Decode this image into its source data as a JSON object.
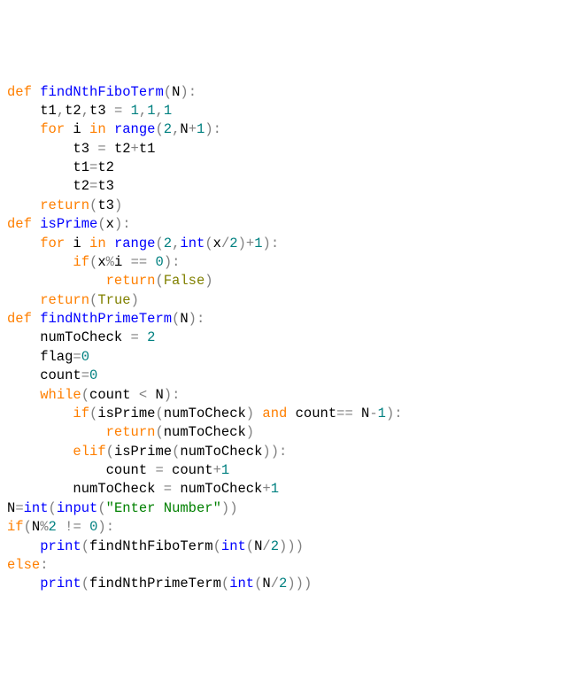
{
  "code": {
    "lines": [
      [
        [
          "kw",
          "def "
        ],
        [
          "fn",
          "findNthFiboTerm"
        ],
        [
          "op",
          "("
        ],
        [
          "",
          "N"
        ],
        [
          "op",
          ")"
        ],
        [
          "op",
          ":"
        ]
      ],
      [
        [
          "",
          "    t1"
        ],
        [
          "op",
          ","
        ],
        [
          "",
          "t2"
        ],
        [
          "op",
          ","
        ],
        [
          "",
          "t3 "
        ],
        [
          "op",
          "="
        ],
        [
          "",
          " "
        ],
        [
          "num",
          "1"
        ],
        [
          "op",
          ","
        ],
        [
          "num",
          "1"
        ],
        [
          "op",
          ","
        ],
        [
          "num",
          "1"
        ]
      ],
      [
        [
          "",
          "    "
        ],
        [
          "kw",
          "for"
        ],
        [
          "",
          " i "
        ],
        [
          "kw",
          "in"
        ],
        [
          "",
          " "
        ],
        [
          "fn",
          "range"
        ],
        [
          "op",
          "("
        ],
        [
          "num",
          "2"
        ],
        [
          "op",
          ","
        ],
        [
          "",
          "N"
        ],
        [
          "op",
          "+"
        ],
        [
          "num",
          "1"
        ],
        [
          "op",
          ")"
        ],
        [
          "op",
          ":"
        ]
      ],
      [
        [
          "",
          "        t3 "
        ],
        [
          "op",
          "="
        ],
        [
          "",
          " t2"
        ],
        [
          "op",
          "+"
        ],
        [
          "",
          "t1"
        ]
      ],
      [
        [
          "",
          "        t1"
        ],
        [
          "op",
          "="
        ],
        [
          "",
          "t2"
        ]
      ],
      [
        [
          "",
          "        t2"
        ],
        [
          "op",
          "="
        ],
        [
          "",
          "t3"
        ]
      ],
      [
        [
          "",
          "    "
        ],
        [
          "kw",
          "return"
        ],
        [
          "op",
          "("
        ],
        [
          "",
          "t3"
        ],
        [
          "op",
          ")"
        ]
      ],
      [
        [
          "",
          ""
        ]
      ],
      [
        [
          "kw",
          "def "
        ],
        [
          "fn",
          "isPrime"
        ],
        [
          "op",
          "("
        ],
        [
          "",
          "x"
        ],
        [
          "op",
          ")"
        ],
        [
          "op",
          ":"
        ]
      ],
      [
        [
          "",
          "    "
        ],
        [
          "kw",
          "for"
        ],
        [
          "",
          " i "
        ],
        [
          "kw",
          "in"
        ],
        [
          "",
          " "
        ],
        [
          "fn",
          "range"
        ],
        [
          "op",
          "("
        ],
        [
          "num",
          "2"
        ],
        [
          "op",
          ","
        ],
        [
          "fn",
          "int"
        ],
        [
          "op",
          "("
        ],
        [
          "",
          "x"
        ],
        [
          "op",
          "/"
        ],
        [
          "num",
          "2"
        ],
        [
          "op",
          ")"
        ],
        [
          "op",
          "+"
        ],
        [
          "num",
          "1"
        ],
        [
          "op",
          ")"
        ],
        [
          "op",
          ":"
        ]
      ],
      [
        [
          "",
          "        "
        ],
        [
          "kw",
          "if"
        ],
        [
          "op",
          "("
        ],
        [
          "",
          "x"
        ],
        [
          "op",
          "%"
        ],
        [
          "",
          "i "
        ],
        [
          "op",
          "=="
        ],
        [
          "",
          " "
        ],
        [
          "num",
          "0"
        ],
        [
          "op",
          ")"
        ],
        [
          "op",
          ":"
        ]
      ],
      [
        [
          "",
          "            "
        ],
        [
          "kw",
          "return"
        ],
        [
          "op",
          "("
        ],
        [
          "bl",
          "False"
        ],
        [
          "op",
          ")"
        ]
      ],
      [
        [
          "",
          "    "
        ],
        [
          "kw",
          "return"
        ],
        [
          "op",
          "("
        ],
        [
          "bl",
          "True"
        ],
        [
          "op",
          ")"
        ]
      ],
      [
        [
          "",
          ""
        ]
      ],
      [
        [
          "kw",
          "def "
        ],
        [
          "fn",
          "findNthPrimeTerm"
        ],
        [
          "op",
          "("
        ],
        [
          "",
          "N"
        ],
        [
          "op",
          ")"
        ],
        [
          "op",
          ":"
        ]
      ],
      [
        [
          "",
          "    numToCheck "
        ],
        [
          "op",
          "="
        ],
        [
          "",
          " "
        ],
        [
          "num",
          "2"
        ]
      ],
      [
        [
          "",
          "    flag"
        ],
        [
          "op",
          "="
        ],
        [
          "num",
          "0"
        ]
      ],
      [
        [
          "",
          "    count"
        ],
        [
          "op",
          "="
        ],
        [
          "num",
          "0"
        ]
      ],
      [
        [
          "",
          "    "
        ],
        [
          "kw",
          "while"
        ],
        [
          "op",
          "("
        ],
        [
          "",
          "count "
        ],
        [
          "op",
          "<"
        ],
        [
          "",
          " N"
        ],
        [
          "op",
          ")"
        ],
        [
          "op",
          ":"
        ]
      ],
      [
        [
          "",
          "        "
        ],
        [
          "kw",
          "if"
        ],
        [
          "op",
          "("
        ],
        [
          "",
          "isPrime"
        ],
        [
          "op",
          "("
        ],
        [
          "",
          "numToCheck"
        ],
        [
          "op",
          ")"
        ],
        [
          "",
          " "
        ],
        [
          "kw",
          "and"
        ],
        [
          "",
          " count"
        ],
        [
          "op",
          "=="
        ],
        [
          "",
          " N"
        ],
        [
          "op",
          "-"
        ],
        [
          "num",
          "1"
        ],
        [
          "op",
          ")"
        ],
        [
          "op",
          ":"
        ]
      ],
      [
        [
          "",
          "            "
        ],
        [
          "kw",
          "return"
        ],
        [
          "op",
          "("
        ],
        [
          "",
          "numToCheck"
        ],
        [
          "op",
          ")"
        ]
      ],
      [
        [
          "",
          "        "
        ],
        [
          "kw",
          "elif"
        ],
        [
          "op",
          "("
        ],
        [
          "",
          "isPrime"
        ],
        [
          "op",
          "("
        ],
        [
          "",
          "numToCheck"
        ],
        [
          "op",
          ")"
        ],
        [
          "op",
          ")"
        ],
        [
          "op",
          ":"
        ]
      ],
      [
        [
          "",
          "            count "
        ],
        [
          "op",
          "="
        ],
        [
          "",
          " count"
        ],
        [
          "op",
          "+"
        ],
        [
          "num",
          "1"
        ]
      ],
      [
        [
          "",
          "        numToCheck "
        ],
        [
          "op",
          "="
        ],
        [
          "",
          " numToCheck"
        ],
        [
          "op",
          "+"
        ],
        [
          "num",
          "1"
        ]
      ],
      [
        [
          "",
          ""
        ]
      ],
      [
        [
          "",
          "N"
        ],
        [
          "op",
          "="
        ],
        [
          "fn",
          "int"
        ],
        [
          "op",
          "("
        ],
        [
          "fn",
          "input"
        ],
        [
          "op",
          "("
        ],
        [
          "str",
          "\"Enter Number\""
        ],
        [
          "op",
          ")"
        ],
        [
          "op",
          ")"
        ]
      ],
      [
        [
          "kw",
          "if"
        ],
        [
          "op",
          "("
        ],
        [
          "",
          "N"
        ],
        [
          "op",
          "%"
        ],
        [
          "num",
          "2"
        ],
        [
          "",
          " "
        ],
        [
          "op",
          "!="
        ],
        [
          "",
          " "
        ],
        [
          "num",
          "0"
        ],
        [
          "op",
          ")"
        ],
        [
          "op",
          ":"
        ]
      ],
      [
        [
          "",
          "    "
        ],
        [
          "fn",
          "print"
        ],
        [
          "op",
          "("
        ],
        [
          "",
          "findNthFiboTerm"
        ],
        [
          "op",
          "("
        ],
        [
          "fn",
          "int"
        ],
        [
          "op",
          "("
        ],
        [
          "",
          "N"
        ],
        [
          "op",
          "/"
        ],
        [
          "num",
          "2"
        ],
        [
          "op",
          ")"
        ],
        [
          "op",
          ")"
        ],
        [
          "op",
          ")"
        ]
      ],
      [
        [
          "kw",
          "else"
        ],
        [
          "op",
          ":"
        ]
      ],
      [
        [
          "",
          "    "
        ],
        [
          "fn",
          "print"
        ],
        [
          "op",
          "("
        ],
        [
          "",
          "findNthPrimeTerm"
        ],
        [
          "op",
          "("
        ],
        [
          "fn",
          "int"
        ],
        [
          "op",
          "("
        ],
        [
          "",
          "N"
        ],
        [
          "op",
          "/"
        ],
        [
          "num",
          "2"
        ],
        [
          "op",
          ")"
        ],
        [
          "op",
          ")"
        ],
        [
          "op",
          ")"
        ]
      ]
    ]
  }
}
